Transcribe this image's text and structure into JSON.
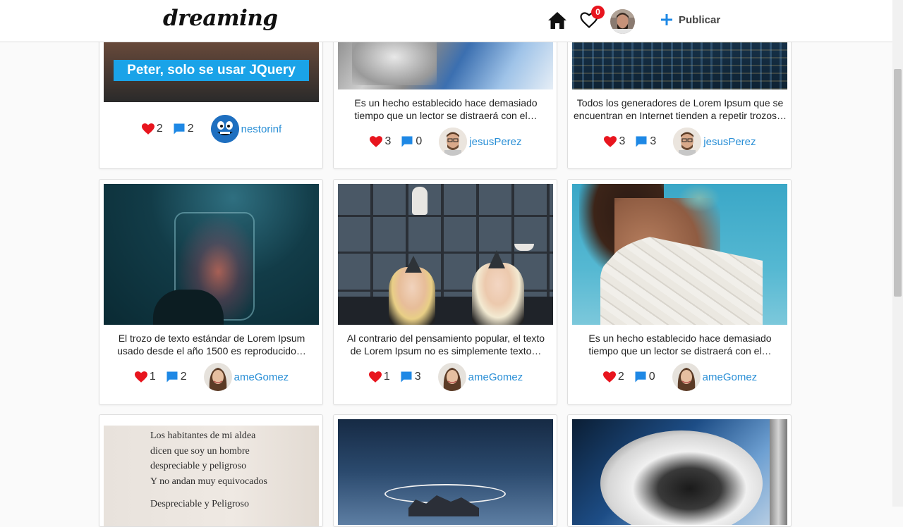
{
  "app": {
    "logo": "dreaming"
  },
  "header": {
    "notifications_count": "0",
    "publish_label": "Publicar"
  },
  "posts": [
    {
      "caption1": "",
      "caption2": "",
      "likes": "2",
      "comments": "2",
      "user": "nestorinf",
      "image_text": "Peter, solo se usar JQuery"
    },
    {
      "caption1": "Es un hecho establecido hace demasiado",
      "caption2": "tiempo que un lector se distraerá con el…",
      "likes": "3",
      "comments": "0",
      "user": "jesusPerez"
    },
    {
      "caption1": "Todos los generadores de Lorem Ipsum que se",
      "caption2": "encuentran en Internet tienden a repetir trozos…",
      "likes": "3",
      "comments": "3",
      "user": "jesusPerez"
    },
    {
      "caption1": "El trozo de texto estándar de Lorem Ipsum",
      "caption2": "usado desde el año 1500 es reproducido…",
      "likes": "1",
      "comments": "2",
      "user": "ameGomez"
    },
    {
      "caption1": "Al contrario del pensamiento popular, el texto",
      "caption2": "de Lorem Ipsum no es simplemente texto…",
      "likes": "1",
      "comments": "3",
      "user": "ameGomez"
    },
    {
      "caption1": "Es un hecho establecido hace demasiado",
      "caption2": "tiempo que un lector se distraerá con el…",
      "likes": "2",
      "comments": "0",
      "user": "ameGomez"
    },
    {
      "image_lines": [
        "Los habitantes de mi aldea",
        "dicen que soy un hombre",
        "despreciable y peligroso",
        "Y no andan muy equivocados",
        "Despreciable y Peligroso"
      ]
    },
    {},
    {}
  ],
  "colors": {
    "heart": "#e8151e",
    "comment": "#1e88e5",
    "link": "#2a8fd6",
    "publish_plus": "#1e88e5"
  }
}
